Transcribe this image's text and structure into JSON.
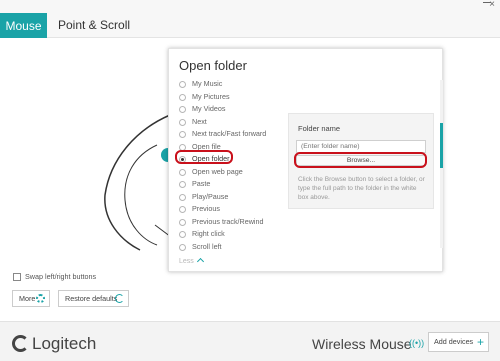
{
  "tabs": [
    {
      "label": "Mouse",
      "active": true
    },
    {
      "label": "Point & Scroll",
      "active": false
    }
  ],
  "panel": {
    "title": "Open folder",
    "options": [
      {
        "label": "My Music",
        "selected": false
      },
      {
        "label": "My Pictures",
        "selected": false
      },
      {
        "label": "My Videos",
        "selected": false
      },
      {
        "label": "Next",
        "selected": false
      },
      {
        "label": "Next track/Fast forward",
        "selected": false
      },
      {
        "label": "Open file",
        "selected": false
      },
      {
        "label": "Open folder",
        "selected": true
      },
      {
        "label": "Open web page",
        "selected": false
      },
      {
        "label": "Paste",
        "selected": false
      },
      {
        "label": "Play/Pause",
        "selected": false
      },
      {
        "label": "Previous",
        "selected": false
      },
      {
        "label": "Previous track/Rewind",
        "selected": false
      },
      {
        "label": "Right click",
        "selected": false
      },
      {
        "label": "Scroll left",
        "selected": false
      }
    ],
    "less_label": "Less",
    "folder": {
      "label": "Folder name",
      "input_value": "",
      "input_placeholder": "(Enter folder name)",
      "browse_label": "Browse...",
      "help_text": "Click the Browse button to select a folder, or type the full path to the folder in the white box above."
    }
  },
  "footer": {
    "swap_label": "Swap left/right buttons",
    "more_label": "More",
    "restore_label": "Restore defaults"
  },
  "bottom": {
    "brand": "Logitech",
    "device_name": "Wireless Mouse",
    "add_devices_label": "Add devices"
  },
  "colors": {
    "accent": "#1aa3a7",
    "highlight_ring": "#c9101b"
  },
  "icons": [
    "minimize-icon",
    "close-icon",
    "gear-icon",
    "refresh-icon",
    "wireless-icon",
    "plus-icon",
    "logitech-logo-icon"
  ]
}
